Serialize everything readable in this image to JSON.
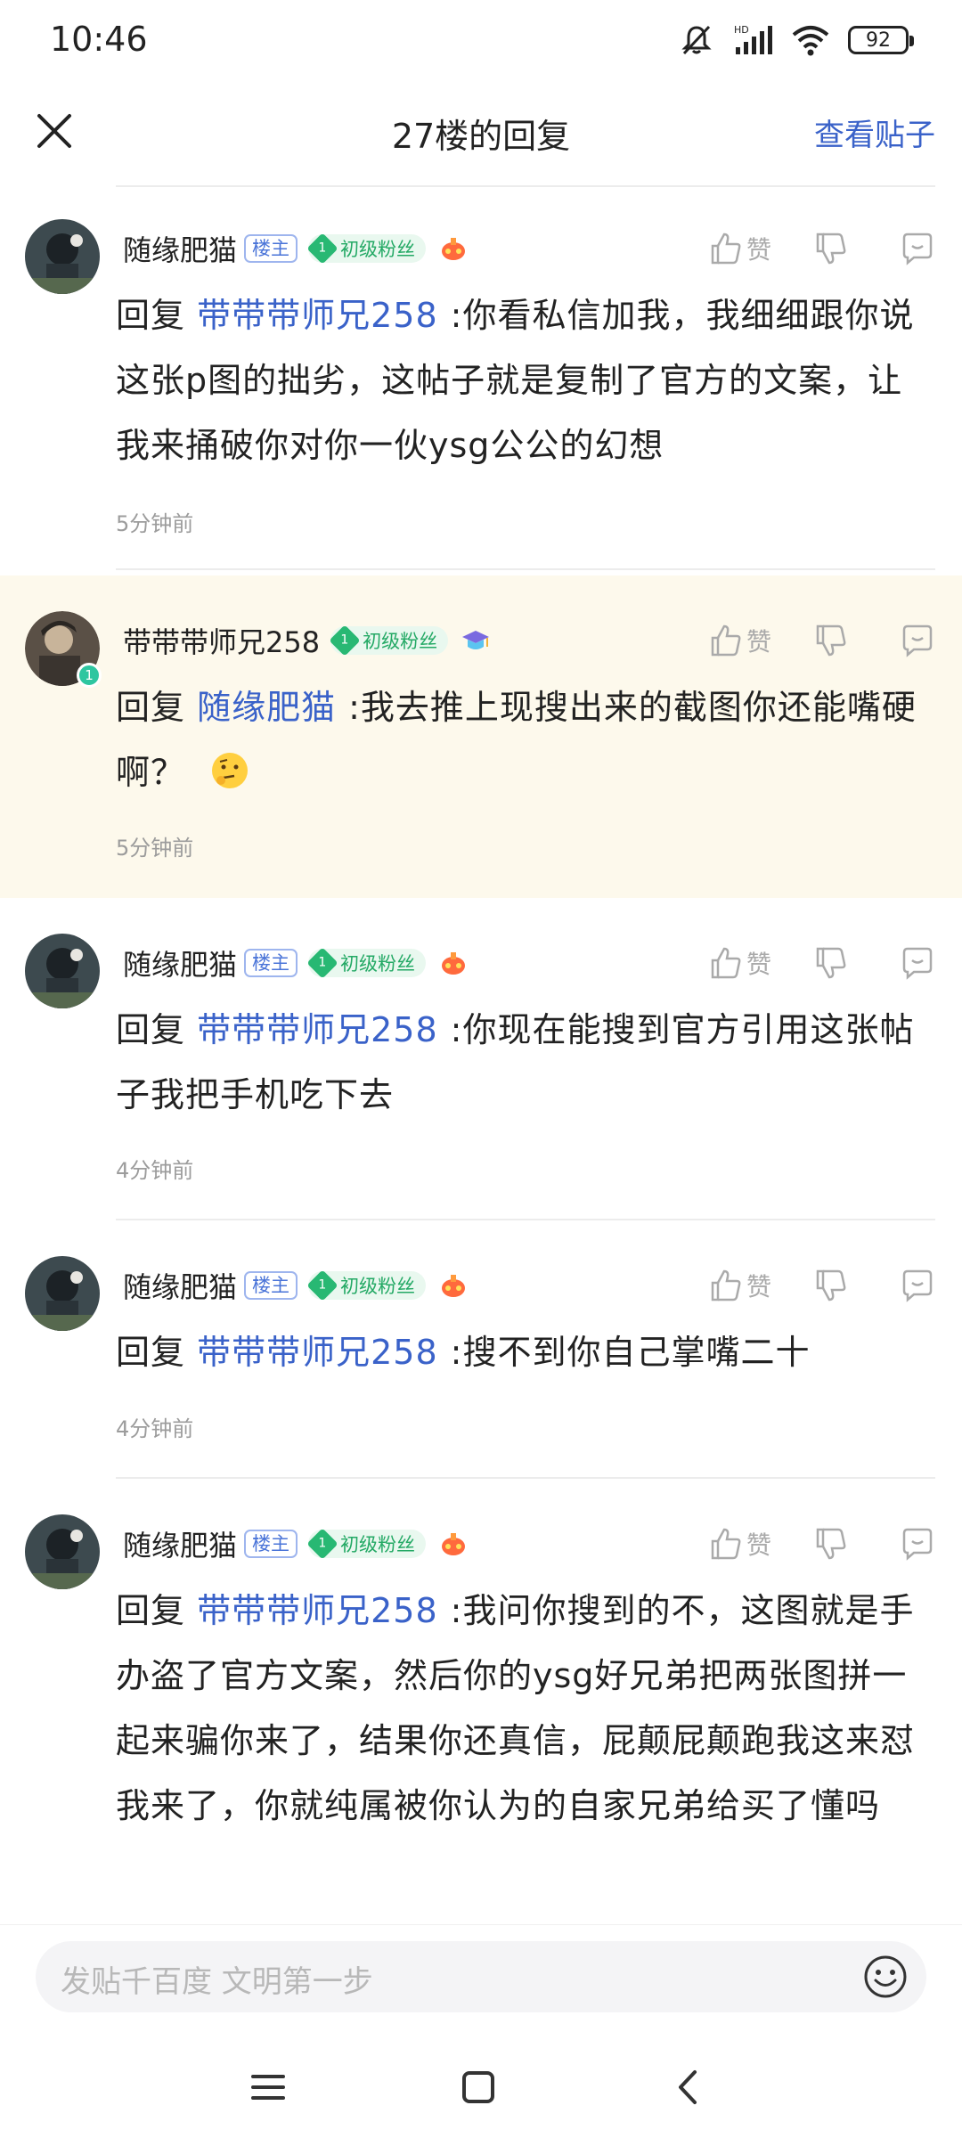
{
  "status": {
    "time": "10:46",
    "battery": "92",
    "icons": [
      "mute-bell-icon",
      "hd-signal-icon",
      "wifi-icon",
      "battery-icon"
    ]
  },
  "header": {
    "title": "27楼的回复",
    "view_post": "查看贴子"
  },
  "labels": {
    "like": "赞",
    "owner_tag": "楼主",
    "fan_level": "1",
    "fan_text": "初级粉丝"
  },
  "replies": [
    {
      "user": "随缘肥猫",
      "reply_prefix": "回复",
      "mention": "带带带师兄258",
      "text": ":你看私信加我，我细细跟你说这张p图的拙劣，这帖子就是复制了官方的文案，让我来捅破你对你一伙ysg公公的幻想",
      "time": "5分钟前"
    },
    {
      "user": "带带带师兄258",
      "reply_prefix": "回复",
      "mention": "随缘肥猫",
      "text": ":我去推上现搜出来的截图你还能嘴硬啊？",
      "time": "5分钟前"
    },
    {
      "user": "随缘肥猫",
      "reply_prefix": "回复",
      "mention": "带带带师兄258",
      "text": ":你现在能搜到官方引用这张帖子我把手机吃下去",
      "time": "4分钟前"
    },
    {
      "user": "随缘肥猫",
      "reply_prefix": "回复",
      "mention": "带带带师兄258",
      "text": ":搜不到你自己掌嘴二十",
      "time": "4分钟前"
    },
    {
      "user": "随缘肥猫",
      "reply_prefix": "回复",
      "mention": "带带带师兄258",
      "text": ":我问你搜到的不，这图就是手办盗了官方文案，然后你的ysg好兄弟把两张图拼一起来骗你来了，结果你还真信，屁颠屁颠跑我这来怼我来了，你就纯属被你认为的自家兄弟给买了懂吗",
      "time": ""
    }
  ],
  "input": {
    "placeholder": "发贴千百度 文明第一步"
  },
  "colors": {
    "accent": "#3a62c9",
    "highlight_bg": "#fdf9ec",
    "fan_green": "#28b873"
  }
}
